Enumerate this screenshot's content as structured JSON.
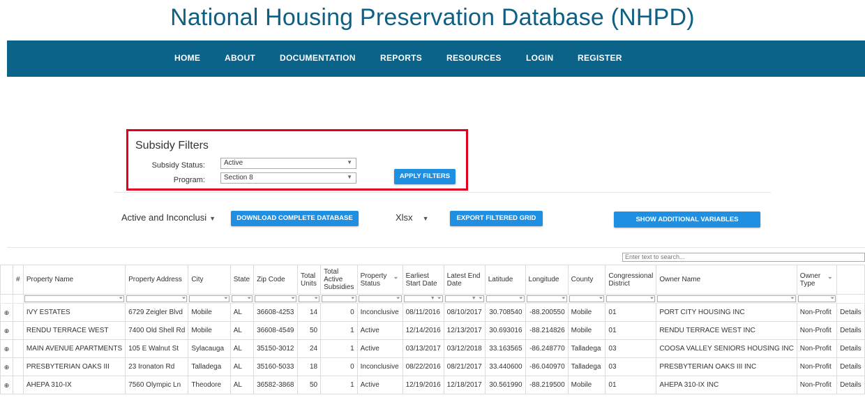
{
  "header": {
    "title": "National Housing Preservation Database (NHPD)"
  },
  "nav": {
    "home": "HOME",
    "about": "ABOUT",
    "documentation": "DOCUMENTATION",
    "reports": "REPORTS",
    "resources": "RESOURCES",
    "login": "LOGIN",
    "register": "REGISTER"
  },
  "filters": {
    "title": "Subsidy Filters",
    "status_label": "Subsidy Status:",
    "status_value": "Active",
    "program_label": "Program:",
    "program_value": "Section 8",
    "apply_label": "APPLY FILTERS"
  },
  "toolbar": {
    "dataset_select": "Active and Inconclusi",
    "download_label": "DOWNLOAD COMPLETE DATABASE",
    "format_select": "Xlsx",
    "export_label": "EXPORT FILTERED GRID",
    "show_vars_label": "SHOW ADDITIONAL VARIABLES"
  },
  "search": {
    "placeholder": "Enter text to search..."
  },
  "table": {
    "columns": [
      "#",
      "Property Name",
      "Property Address",
      "City",
      "State",
      "Zip Code",
      "Total Units",
      "Total Active Subsidies",
      "Property Status",
      "Earliest Start Date",
      "Latest End Date",
      "Latitude",
      "Longitude",
      "County",
      "Congressional District",
      "Owner Name",
      "Owner Type",
      ""
    ],
    "rows": [
      {
        "name": "IVY ESTATES",
        "address": "6729 Zeigler Blvd",
        "city": "Mobile",
        "state": "AL",
        "zip": "36608-4253",
        "units": "14",
        "subsidies": "0",
        "status": "Inconclusive",
        "start": "08/11/2016",
        "end": "08/10/2017",
        "lat": "30.708540",
        "lon": "-88.200550",
        "county": "Mobile",
        "district": "01",
        "owner": "PORT CITY HOUSING INC",
        "owner_type": "Non-Profit",
        "detail": "Details"
      },
      {
        "name": "RENDU TERRACE WEST",
        "address": "7400 Old Shell Rd",
        "city": "Mobile",
        "state": "AL",
        "zip": "36608-4549",
        "units": "50",
        "subsidies": "1",
        "status": "Active",
        "start": "12/14/2016",
        "end": "12/13/2017",
        "lat": "30.693016",
        "lon": "-88.214826",
        "county": "Mobile",
        "district": "01",
        "owner": "RENDU TERRACE WEST INC",
        "owner_type": "Non-Profit",
        "detail": "Details"
      },
      {
        "name": "MAIN AVENUE APARTMENTS",
        "address": "105 E Walnut St",
        "city": "Sylacauga",
        "state": "AL",
        "zip": "35150-3012",
        "units": "24",
        "subsidies": "1",
        "status": "Active",
        "start": "03/13/2017",
        "end": "03/12/2018",
        "lat": "33.163565",
        "lon": "-86.248770",
        "county": "Talladega",
        "district": "03",
        "owner": "COOSA VALLEY SENIORS HOUSING INC",
        "owner_type": "Non-Profit",
        "detail": "Details"
      },
      {
        "name": "PRESBYTERIAN OAKS III",
        "address": "23 Ironaton Rd",
        "city": "Talladega",
        "state": "AL",
        "zip": "35160-5033",
        "units": "18",
        "subsidies": "0",
        "status": "Inconclusive",
        "start": "08/22/2016",
        "end": "08/21/2017",
        "lat": "33.440600",
        "lon": "-86.040970",
        "county": "Talladega",
        "district": "03",
        "owner": "PRESBYTERIAN OAKS III INC",
        "owner_type": "Non-Profit",
        "detail": "Details"
      },
      {
        "name": "AHEPA 310-IX",
        "address": "7560 Olympic Ln",
        "city": "Theodore",
        "state": "AL",
        "zip": "36582-3868",
        "units": "50",
        "subsidies": "1",
        "status": "Active",
        "start": "12/19/2016",
        "end": "12/18/2017",
        "lat": "30.561990",
        "lon": "-88.219500",
        "county": "Mobile",
        "district": "01",
        "owner": "AHEPA 310-IX INC",
        "owner_type": "Non-Profit",
        "detail": "Details"
      }
    ]
  }
}
